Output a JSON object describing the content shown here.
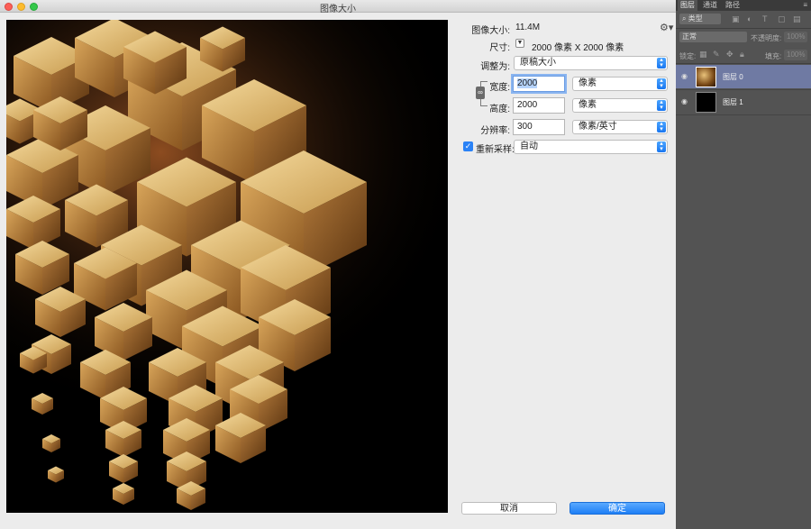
{
  "dialog": {
    "title": "图像大小",
    "image_size_label": "图像大小:",
    "image_size_value": "11.4M",
    "dimensions_label": "尺寸:",
    "dimensions_value": "2000 像素  X  2000 像素",
    "fit_to_label": "调整为:",
    "fit_to_value": "原稿大小",
    "width_label": "宽度:",
    "width_value": "2000",
    "width_unit": "像素",
    "height_label": "高度:",
    "height_value": "2000",
    "height_unit": "像素",
    "resolution_label": "分辨率:",
    "resolution_value": "300",
    "resolution_unit": "像素/英寸",
    "resample_label": "重新采样:",
    "resample_checked": true,
    "resample_value": "自动",
    "cancel_label": "取消",
    "ok_label": "确定"
  },
  "panel": {
    "tabs": [
      "图层",
      "通道",
      "路径"
    ],
    "active_tab": 0,
    "filter_label": "类型",
    "blend_mode": "正常",
    "opacity_label": "不透明度:",
    "opacity_value": "100%",
    "lock_label": "锁定:",
    "fill_label": "填充:",
    "fill_value": "100%",
    "layers": [
      {
        "name": "图层 0",
        "selected": true,
        "thumb": "cubes"
      },
      {
        "name": "图层 1",
        "selected": false,
        "thumb": "black"
      }
    ]
  },
  "colors": {
    "accent": "#1e7ef5",
    "selected_layer": "#6f7aa3",
    "panel_bg": "#535353",
    "dialog_bg": "#ececec"
  }
}
